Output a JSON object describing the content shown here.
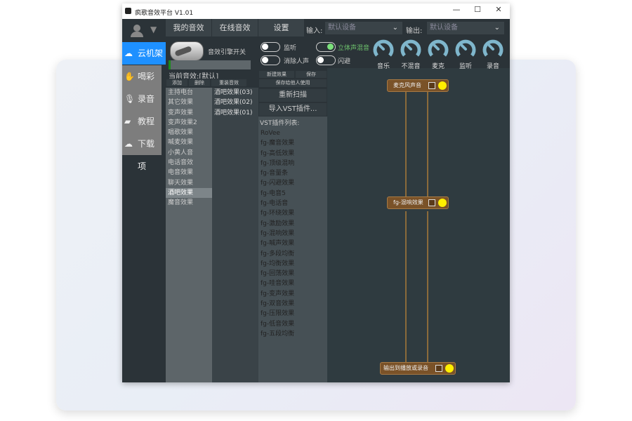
{
  "window": {
    "title": "疯歌音效平台 V1.01",
    "controls": [
      "—",
      "☐",
      "✕"
    ]
  },
  "sidebar": {
    "items": [
      {
        "label": "云机架",
        "icon": "cloud-icon",
        "active": true
      },
      {
        "label": "喝彩声",
        "icon": "clap-icon"
      },
      {
        "label": "录音室",
        "icon": "mic-icon"
      },
      {
        "label": "教程",
        "icon": "board-icon"
      },
      {
        "label": "下载项",
        "icon": "cloud-download-icon"
      }
    ]
  },
  "tabs": [
    "我的音效",
    "在线音效",
    "设置"
  ],
  "io": {
    "input_label": "输入:",
    "input_value": "默认设备",
    "output_label": "输出:",
    "output_value": "默认设备"
  },
  "engine": {
    "label": "音效引擎开关"
  },
  "toggles": [
    {
      "label": "监听",
      "on": false
    },
    {
      "label": "消除人声",
      "on": false
    },
    {
      "label": "立体声混音",
      "on": true
    },
    {
      "label": "闪避",
      "on": false
    }
  ],
  "knobs": [
    "音乐",
    "不混音",
    "麦克",
    "监听",
    "录音"
  ],
  "current": {
    "label": "当前音效:[默认]",
    "buttons": [
      "添加",
      "删除",
      "重装音效"
    ]
  },
  "effects": [
    "主持电台",
    "其它效果",
    "变声效果",
    "变声效果2",
    "唱歌效果",
    "喊麦效果",
    "小黄人音",
    "电话音效",
    "电音效果",
    "聊天效果",
    "酒吧效果",
    "魔音效果"
  ],
  "selected_effect": "酒吧效果",
  "presets": [
    "酒吧效果(03)",
    "酒吧效果(02)",
    "酒吧效果(01)"
  ],
  "actions": {
    "new": "新建效果",
    "save": "保存",
    "share": "保存给他人使用",
    "rescan": "重新扫描",
    "import": "导入VST插件..."
  },
  "vst": {
    "title": "VST插件列表:",
    "items": [
      "RoVee",
      "fg-魔音效果",
      "fg-高低效果",
      "fg-顶级混响",
      "fg-音量条",
      "fg-闪避效果",
      "fg-电音5",
      "fg-电话音",
      "fg-环绕效果",
      "fg-激励效果",
      "fg-混响效果",
      "fg-喊声效果",
      "fg-多段均衡",
      "fg-均衡效果",
      "fg-回荡效果",
      "fg-哇音效果",
      "fg-变声效果",
      "fg-双音效果",
      "fg-压限效果",
      "fg-低音效果",
      "fg-五段均衡"
    ]
  },
  "nodes": [
    "麦克风声音",
    "fg-混响效果",
    "输出到播放或录音"
  ],
  "colors": {
    "accent": "#1e90ff",
    "node": "#7a5228",
    "on": "#7be07b",
    "indicator": "#ffef00"
  }
}
